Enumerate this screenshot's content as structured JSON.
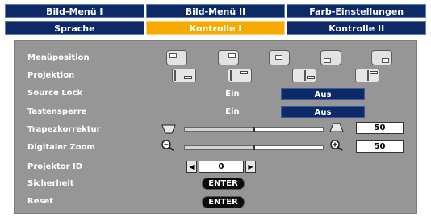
{
  "tabs_row1": [
    {
      "label": "Bild-Menü I"
    },
    {
      "label": "Bild-Menü II"
    },
    {
      "label": "Farb-Einstellungen"
    }
  ],
  "tabs_row2": [
    {
      "label": "Sprache"
    },
    {
      "label": "Kontrolle I",
      "active": true
    },
    {
      "label": "Kontrolle II"
    }
  ],
  "items": {
    "menu_position": "Menüposition",
    "projection": "Projektion",
    "source_lock": "Source Lock",
    "keypad_lock": "Tastensperre",
    "keystone": "Trapezkorrektur",
    "digital_zoom": "Digitaler Zoom",
    "projector_id": "Projektor ID",
    "security": "Sicherheit",
    "reset": "Reset"
  },
  "source_lock": {
    "on_label": "Ein",
    "off_label": "Aus",
    "selected": "Aus"
  },
  "keypad_lock": {
    "on_label": "Ein",
    "off_label": "Aus",
    "selected": "Aus"
  },
  "keystone": {
    "value": "50",
    "fraction": 0.5
  },
  "digital_zoom": {
    "value": "50",
    "fraction": 0.5
  },
  "projector_id": {
    "value": "0",
    "left_arrow": "◀",
    "right_arrow": "▶"
  },
  "security": {
    "button_label": "ENTER"
  },
  "reset": {
    "button_label": "ENTER"
  },
  "colors": {
    "tab_bg": "#0d2a67",
    "tab_active": "#f6a900",
    "panel_bg": "#969696",
    "selected_bg": "#0d2a67"
  }
}
